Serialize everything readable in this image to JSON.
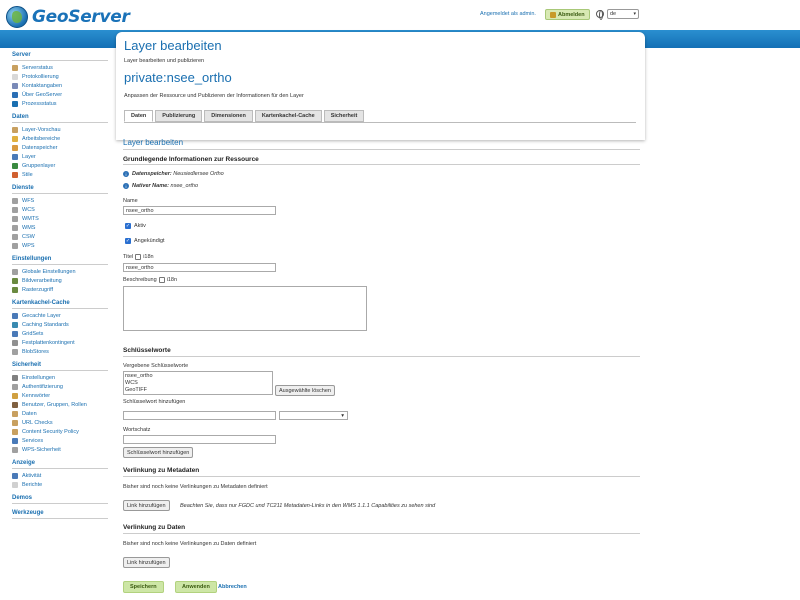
{
  "header": {
    "app_name": "GeoServer",
    "login_text": "Angemeldet als admin.",
    "logout_label": "Abmelden",
    "language": "de"
  },
  "sidebar": {
    "sections": [
      {
        "title": "Server",
        "items": [
          {
            "label": "Serverstatus",
            "icon": "server-status-icon",
            "color": "#c8a060"
          },
          {
            "label": "Protokollierung",
            "icon": "log-icon",
            "color": "#d8d8d8"
          },
          {
            "label": "Kontaktangaben",
            "icon": "contact-icon",
            "color": "#7a8ab8"
          },
          {
            "label": "Über GeoServer",
            "icon": "info-icon",
            "color": "#2a6fb5"
          },
          {
            "label": "Prozessstatus",
            "icon": "process-icon",
            "color": "#1a6fb0"
          }
        ]
      },
      {
        "title": "Daten",
        "items": [
          {
            "label": "Layer-Vorschau",
            "icon": "preview-icon",
            "color": "#c8a060"
          },
          {
            "label": "Arbeitsbereiche",
            "icon": "folder-icon",
            "color": "#e0b040"
          },
          {
            "label": "Datenspeicher",
            "icon": "database-icon",
            "color": "#d89a40"
          },
          {
            "label": "Layer",
            "icon": "layer-icon",
            "color": "#4a7ab8"
          },
          {
            "label": "Gruppenlayer",
            "icon": "layer-group-icon",
            "color": "#3a8a40"
          },
          {
            "label": "Stile",
            "icon": "style-icon",
            "color": "#d06030"
          }
        ]
      },
      {
        "title": "Dienste",
        "items": [
          {
            "label": "WFS",
            "icon": "service-icon",
            "color": "#a0a0a0"
          },
          {
            "label": "WCS",
            "icon": "service-icon",
            "color": "#a0a0a0"
          },
          {
            "label": "WMTS",
            "icon": "service-icon",
            "color": "#a0a0a0"
          },
          {
            "label": "WMS",
            "icon": "service-icon",
            "color": "#a0a0a0"
          },
          {
            "label": "CSW",
            "icon": "service-icon",
            "color": "#a0a0a0"
          },
          {
            "label": "WPS",
            "icon": "service-icon",
            "color": "#a0a0a0"
          }
        ]
      },
      {
        "title": "Einstellungen",
        "items": [
          {
            "label": "Globale Einstellungen",
            "icon": "settings-icon",
            "color": "#a0a0a0"
          },
          {
            "label": "Bildverarbeitung",
            "icon": "image-icon",
            "color": "#6a8a40"
          },
          {
            "label": "Rasterzugriff",
            "icon": "raster-icon",
            "color": "#6a8a40"
          }
        ]
      },
      {
        "title": "Kartenkachel-Cache",
        "items": [
          {
            "label": "Gecachte Layer",
            "icon": "cached-layer-icon",
            "color": "#4a7ab8"
          },
          {
            "label": "Caching Standards",
            "icon": "globe-icon",
            "color": "#3a8ab0"
          },
          {
            "label": "GridSets",
            "icon": "grid-icon",
            "color": "#4a7ab8"
          },
          {
            "label": "Festplattenkontingent",
            "icon": "disk-icon",
            "color": "#909090"
          },
          {
            "label": "BlobStores",
            "icon": "blob-icon",
            "color": "#a0a0a0"
          }
        ]
      },
      {
        "title": "Sicherheit",
        "items": [
          {
            "label": "Einstellungen",
            "icon": "key-icon",
            "color": "#808080"
          },
          {
            "label": "Authentifizierung",
            "icon": "auth-icon",
            "color": "#a0a0a0"
          },
          {
            "label": "Kennwörter",
            "icon": "lock-icon",
            "color": "#d0a040"
          },
          {
            "label": "Benutzer, Gruppen, Rollen",
            "icon": "users-icon",
            "color": "#806040"
          },
          {
            "label": "Daten",
            "icon": "data-security-icon",
            "color": "#c8a060"
          },
          {
            "label": "URL Checks",
            "icon": "url-icon",
            "color": "#c8a060"
          },
          {
            "label": "Content Security Policy",
            "icon": "policy-icon",
            "color": "#c8a060"
          },
          {
            "label": "Services",
            "icon": "services-icon",
            "color": "#4a7ab8"
          },
          {
            "label": "WPS-Sicherheit",
            "icon": "wps-security-icon",
            "color": "#a0a0a0"
          }
        ]
      },
      {
        "title": "Anzeige",
        "items": [
          {
            "label": "Aktivität",
            "icon": "activity-icon",
            "color": "#4a7ab8"
          },
          {
            "label": "Berichte",
            "icon": "report-icon",
            "color": "#d0d0d0"
          }
        ]
      }
    ],
    "demos": "Demos",
    "tools": "Werkzeuge"
  },
  "main": {
    "title": "Layer bearbeiten",
    "subtitle": "Layer bearbeiten und publizieren",
    "layer_name": "private:nsee_ortho",
    "description": "Anpassen der Ressource und Publizieren der Informationen für den Layer",
    "tabs": [
      "Daten",
      "Publizierung",
      "Dimensionen",
      "Kartenkachel-Cache",
      "Sicherheit"
    ],
    "active_tab": "Daten"
  },
  "form": {
    "section_title": "Layer bearbeiten",
    "basic_heading": "Grundlegende Informationen zur Ressource",
    "store_label": "Datenspeicher:",
    "store_value": "Neusiedlersee Ortho",
    "native_label": "Nativer Name:",
    "native_value": "nsee_ortho",
    "name_label": "Name",
    "name_value": "nsee_ortho",
    "enabled_label": "Aktiv",
    "advertised_label": "Angekündigt",
    "title_label": "Titel",
    "i18n_label": "i18n",
    "title_value": "nsee_ortho",
    "abstract_label": "Beschreibung",
    "keywords_heading": "Schlüsselworte",
    "current_keywords_label": "Vergebene Schlüsselworte",
    "keywords": [
      "nsee_ortho",
      "WCS",
      "GeoTIFF"
    ],
    "remove_selected": "Ausgewählte löschen",
    "add_keyword_label": "Schlüsselwort hinzufügen",
    "vocabulary_label": "Wortschatz",
    "add_keyword_button": "Schlüsselwort hinzufügen",
    "metadata_heading": "Verlinkung zu Metadaten",
    "metadata_empty": "Bisher sind noch keine Verlinkungen zu Metadaten definiert",
    "add_link": "Link hinzufügen",
    "metadata_note": "Beachten Sie, dass nur FGDC und TC211 Metadaten-Links in den WMS 1.1.1 Capabilities zu sehen sind",
    "data_links_heading": "Verlinkung zu Daten",
    "data_links_empty": "Bisher sind noch keine Verlinkungen zu Daten definiert",
    "add_data_link": "Link hinzufügen",
    "save": "Speichern",
    "apply": "Anwenden",
    "cancel": "Abbrechen"
  },
  "colors": {
    "accent": "#1a6fb0",
    "header_bar": "#1a7fc4",
    "green_button": "#cde6a6"
  }
}
